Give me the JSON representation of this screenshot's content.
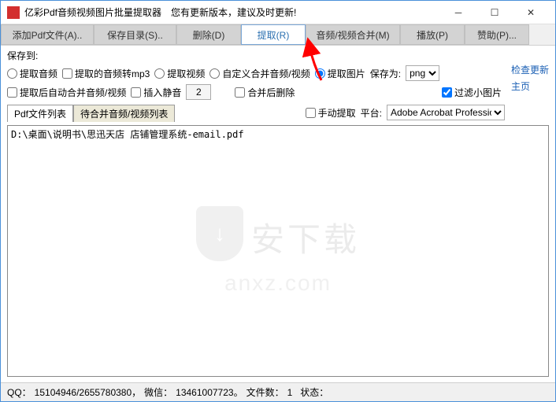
{
  "window": {
    "title": "亿彩Pdf音频视频图片批量提取器",
    "subtitle": "您有更新版本，建议及时更新!"
  },
  "toolbar": {
    "add": "添加Pdf文件(A)..",
    "savedir": "保存目录(S)..",
    "delete": "删除(D)",
    "extract": "提取(R)",
    "merge": "音频/视频合并(M)",
    "play": "播放(P)",
    "sponsor": "赞助(P)..."
  },
  "options": {
    "save_to_label": "保存到:",
    "extract_audio": "提取音频",
    "audio_to_mp3": "提取的音频转mp3",
    "extract_video": "提取视频",
    "custom_merge": "自定义合并音频/视频",
    "extract_image": "提取图片",
    "save_as_label": "保存为:",
    "save_as_value": "png",
    "auto_merge": "提取后自动合并音频/视频",
    "insert_silence": "插入静音",
    "silence_value": "2",
    "delete_after_merge": "合并后删除",
    "filter_small": "过滤小图片",
    "manual_extract": "手动提取",
    "platform_label": "平台:",
    "platform_value": "Adobe Acrobat Profession",
    "check_update": "检查更新",
    "homepage": "主页"
  },
  "tabs": {
    "pdf_list": "Pdf文件列表",
    "merge_list": "待合并音频/视频列表"
  },
  "files": [
    "D:\\桌面\\说明书\\思迅天店 店铺管理系统-email.pdf"
  ],
  "watermark": {
    "text1": "安下载",
    "text2": "anxz.com"
  },
  "status": {
    "qq_label": "QQ：",
    "qq": "15104946/2655780380，",
    "wechat_label": "微信：",
    "wechat": "13461007723。",
    "files_label": "文件数：",
    "files_count": "1",
    "state_label": "状态："
  }
}
